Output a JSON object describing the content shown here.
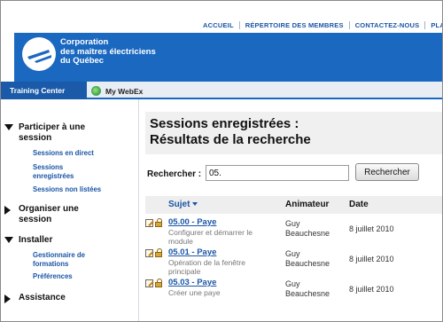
{
  "topnav": {
    "links": [
      "ACCUEIL",
      "RÉPERTOIRE DES MEMBRES",
      "CONTACTEZ-NOUS",
      "PLAN"
    ]
  },
  "header": {
    "org_line1": "Corporation",
    "org_line2": "des maîtres électriciens",
    "org_line3": "du Québec",
    "brand_color": "#1a68c0"
  },
  "tabs": {
    "active": "Training Center",
    "webex": "My WebEx"
  },
  "sidebar": {
    "sections": [
      {
        "title": [
          "Participer à une",
          "session"
        ],
        "expanded": true,
        "links": [
          [
            "Sessions en direct"
          ],
          [
            "Sessions",
            "enregistrées"
          ],
          [
            "Sessions non listées"
          ]
        ]
      },
      {
        "title": [
          "Organiser une",
          "session"
        ],
        "expanded": false,
        "links": []
      },
      {
        "title": [
          "Installer"
        ],
        "expanded": true,
        "links": [
          [
            "Gestionnaire de",
            "formations"
          ],
          [
            "Préférences"
          ]
        ]
      },
      {
        "title": [
          "Assistance"
        ],
        "expanded": false,
        "links": []
      }
    ]
  },
  "main": {
    "title_line1": "Sessions enregistrées :",
    "title_line2": "Résultats de la recherche",
    "search_label": "Rechercher :",
    "search_value": "05.",
    "search_button": "Rechercher",
    "columns": {
      "subject": "Sujet",
      "host": "Animateur",
      "date": "Date"
    },
    "rows": [
      {
        "topic": "05.00 - Paye",
        "desc": [
          "Configurer et démarrer le",
          "module"
        ],
        "host": [
          "Guy",
          "Beauchesne"
        ],
        "date": "8 juillet 2010"
      },
      {
        "topic": "05.01 - Paye",
        "desc": [
          "Opération de la fenêtre",
          "principale"
        ],
        "host": [
          "Guy",
          "Beauchesne"
        ],
        "date": "8 juillet 2010"
      },
      {
        "topic": "05.03 - Paye",
        "desc": [
          "Créer une paye"
        ],
        "host": [
          "Guy",
          "Beauchesne"
        ],
        "date": "8 juillet 2010"
      }
    ]
  }
}
